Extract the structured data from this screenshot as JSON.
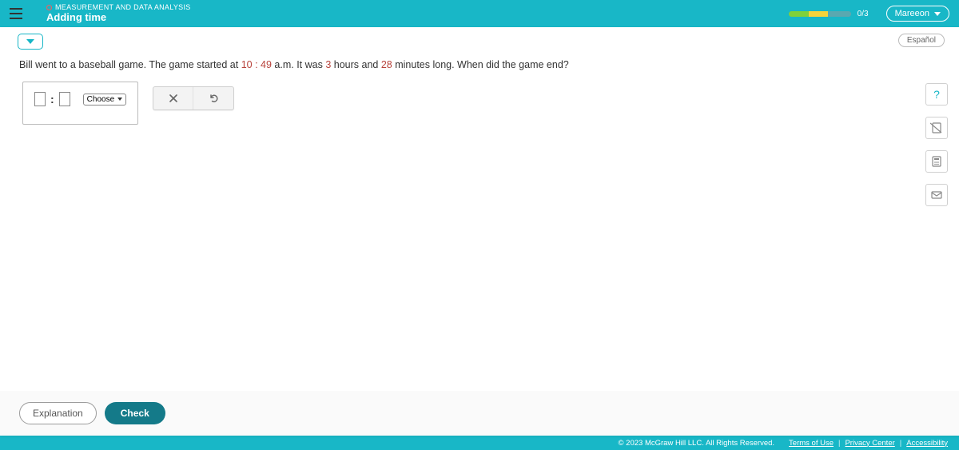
{
  "header": {
    "category": "MEASUREMENT AND DATA ANALYSIS",
    "title": "Adding time",
    "progress_text": "0/3",
    "user_name": "Mareeon"
  },
  "toolbar": {
    "language": "Español"
  },
  "question": {
    "pre": "Bill went to a baseball game. The game started at ",
    "time": "10 : 49",
    "mid1": " a.m. It was ",
    "hours": "3",
    "mid2": " hours and ",
    "minutes": "28",
    "post": " minutes long. When did the game end?"
  },
  "input": {
    "choose_label": "Choose"
  },
  "controls": {
    "explanation": "Explanation",
    "check": "Check"
  },
  "footer": {
    "copyright": "© 2023 McGraw Hill LLC. All Rights Reserved.",
    "terms": "Terms of Use",
    "privacy": "Privacy Center",
    "accessibility": "Accessibility"
  }
}
